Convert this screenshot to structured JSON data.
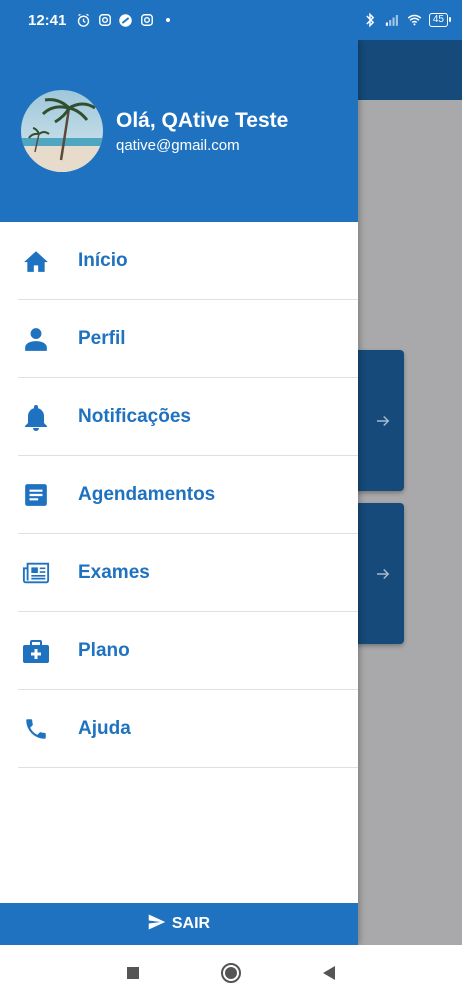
{
  "status_bar": {
    "time": "12:41",
    "battery_level": "45"
  },
  "user": {
    "greeting": "Olá, QAtive Teste",
    "email": "qative@gmail.com"
  },
  "menu": {
    "items": [
      {
        "label": "Início",
        "icon": "home-icon"
      },
      {
        "label": "Perfil",
        "icon": "person-icon"
      },
      {
        "label": "Notificações",
        "icon": "bell-icon"
      },
      {
        "label": "Agendamentos",
        "icon": "document-icon"
      },
      {
        "label": "Exames",
        "icon": "newspaper-icon"
      },
      {
        "label": "Plano",
        "icon": "medical-bag-icon"
      },
      {
        "label": "Ajuda",
        "icon": "phone-icon"
      }
    ]
  },
  "logout": {
    "label": "SAIR",
    "icon": "send-icon"
  },
  "colors": {
    "primary": "#1f72bf",
    "dark_primary": "#154a7a",
    "scrim": "#a9a9ab"
  }
}
